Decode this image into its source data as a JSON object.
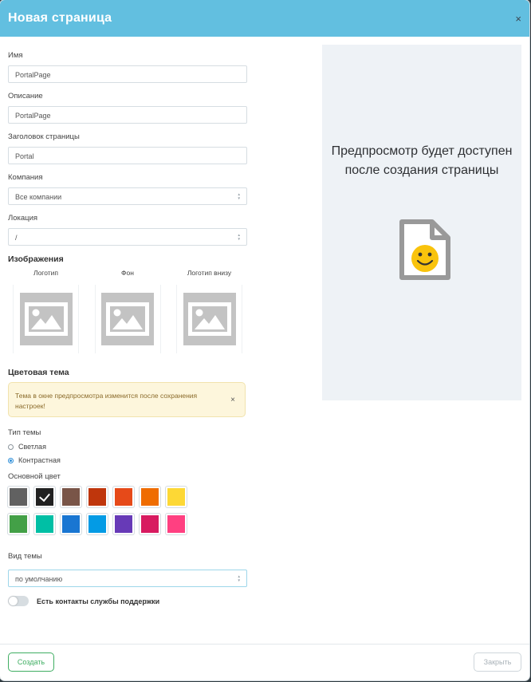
{
  "dialog": {
    "title": "Новая страница",
    "close_glyph": "×"
  },
  "form": {
    "name": {
      "label": "Имя",
      "value": "PortalPage"
    },
    "description": {
      "label": "Описание",
      "value": "PortalPage"
    },
    "page_title": {
      "label": "Заголовок страницы",
      "value": "Portal"
    },
    "company": {
      "label": "Компания",
      "value": "Все компании"
    },
    "location": {
      "label": "Локация",
      "value": "/"
    }
  },
  "images": {
    "title": "Изображения",
    "items": [
      {
        "label": "Логотип",
        "icon": "image-placeholder-icon"
      },
      {
        "label": "Фон",
        "icon": "image-placeholder-icon"
      },
      {
        "label": "Логотип внизу",
        "icon": "image-placeholder-icon"
      }
    ]
  },
  "theme": {
    "title": "Цветовая тема",
    "alert": {
      "text": "Тема в окне предпросмотра изменится после сохранения настроек!",
      "close_glyph": "×"
    },
    "type_label": "Тип темы",
    "options": [
      {
        "label": "Светлая",
        "checked": false
      },
      {
        "label": "Контрастная",
        "checked": true
      }
    ],
    "color_label": "Основной цвет",
    "colors": [
      "#616161",
      "#212121",
      "#795548",
      "#bf360c",
      "#e64a19",
      "#ef6c00",
      "#fdd835",
      "#43a047",
      "#00bfa5",
      "#1976d2",
      "#039be5",
      "#673ab7",
      "#d81b60",
      "#ff4081"
    ],
    "selected_color": "#212121",
    "view_label": "Вид темы",
    "view_value": "по умолчанию"
  },
  "support": {
    "label": "Есть контакты службы поддержки",
    "enabled": false
  },
  "preview": {
    "text": "Предпросмотр будет доступен после создания страницы",
    "icon": "smiley-document-icon"
  },
  "footer": {
    "create": "Создать",
    "close": "Закрыть"
  },
  "colors": {
    "header": "#62bfe0",
    "accent_green": "#3fae62",
    "alert_bg": "#fdf6dc",
    "preview_bg": "#eef2f6"
  }
}
